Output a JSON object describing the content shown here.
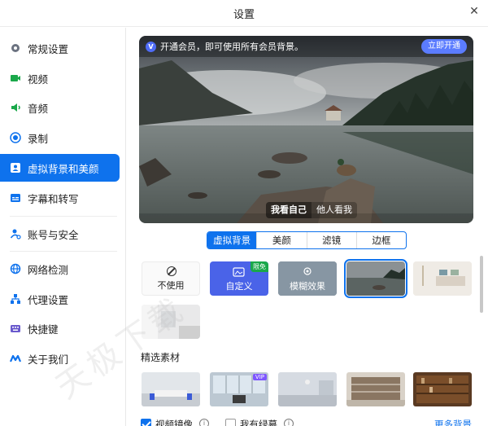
{
  "window": {
    "title": "设置",
    "close_icon": "close-icon"
  },
  "sidebar": {
    "items": [
      {
        "label": "常规设置",
        "icon": "gear-icon",
        "color": "#6b7280"
      },
      {
        "label": "视频",
        "icon": "video-camera-icon",
        "color": "#1aa84a"
      },
      {
        "label": "音频",
        "icon": "speaker-icon",
        "color": "#1aa84a"
      },
      {
        "label": "录制",
        "icon": "record-icon",
        "color": "#0e72ed"
      },
      {
        "label": "虚拟背景和美颜",
        "icon": "portrait-icon",
        "color": "#ffffff",
        "active": true
      },
      {
        "label": "字幕和转写",
        "icon": "captions-icon",
        "color": "#0e72ed"
      },
      {
        "label": "账号与安全",
        "icon": "account-security-icon",
        "color": "#0e72ed"
      },
      {
        "label": "网络检测",
        "icon": "globe-icon",
        "color": "#0e72ed"
      },
      {
        "label": "代理设置",
        "icon": "proxy-network-icon",
        "color": "#0e72ed"
      },
      {
        "label": "快捷键",
        "icon": "keyboard-icon",
        "color": "#6a5acd"
      },
      {
        "label": "关于我们",
        "icon": "logo-icon",
        "color": "#0e72ed"
      }
    ]
  },
  "preview": {
    "banner_text": "开通会员，即可使用所有会员背景。",
    "open_button": "立即开通",
    "view_self": "我看自己",
    "view_others": "他人看我"
  },
  "tabs": [
    {
      "label": "虚拟背景",
      "active": true
    },
    {
      "label": "美颜"
    },
    {
      "label": "滤镜"
    },
    {
      "label": "边框"
    }
  ],
  "backgrounds": {
    "none_label": "不使用",
    "custom_label": "自定义",
    "custom_ribbon": "限免",
    "blur_label": "模糊效果"
  },
  "materials": {
    "title": "精选素材",
    "vip_tag": "VIP"
  },
  "options": {
    "mirror_label": "视频镜像",
    "mirror_checked": true,
    "greenscreen_label": "我有绿幕",
    "greenscreen_checked": false,
    "more_link": "更多背景"
  },
  "watermark_text": "天极下载",
  "colors": {
    "accent": "#0e72ed",
    "vip": "#5b7cff",
    "free_ribbon": "#1aa84a"
  }
}
